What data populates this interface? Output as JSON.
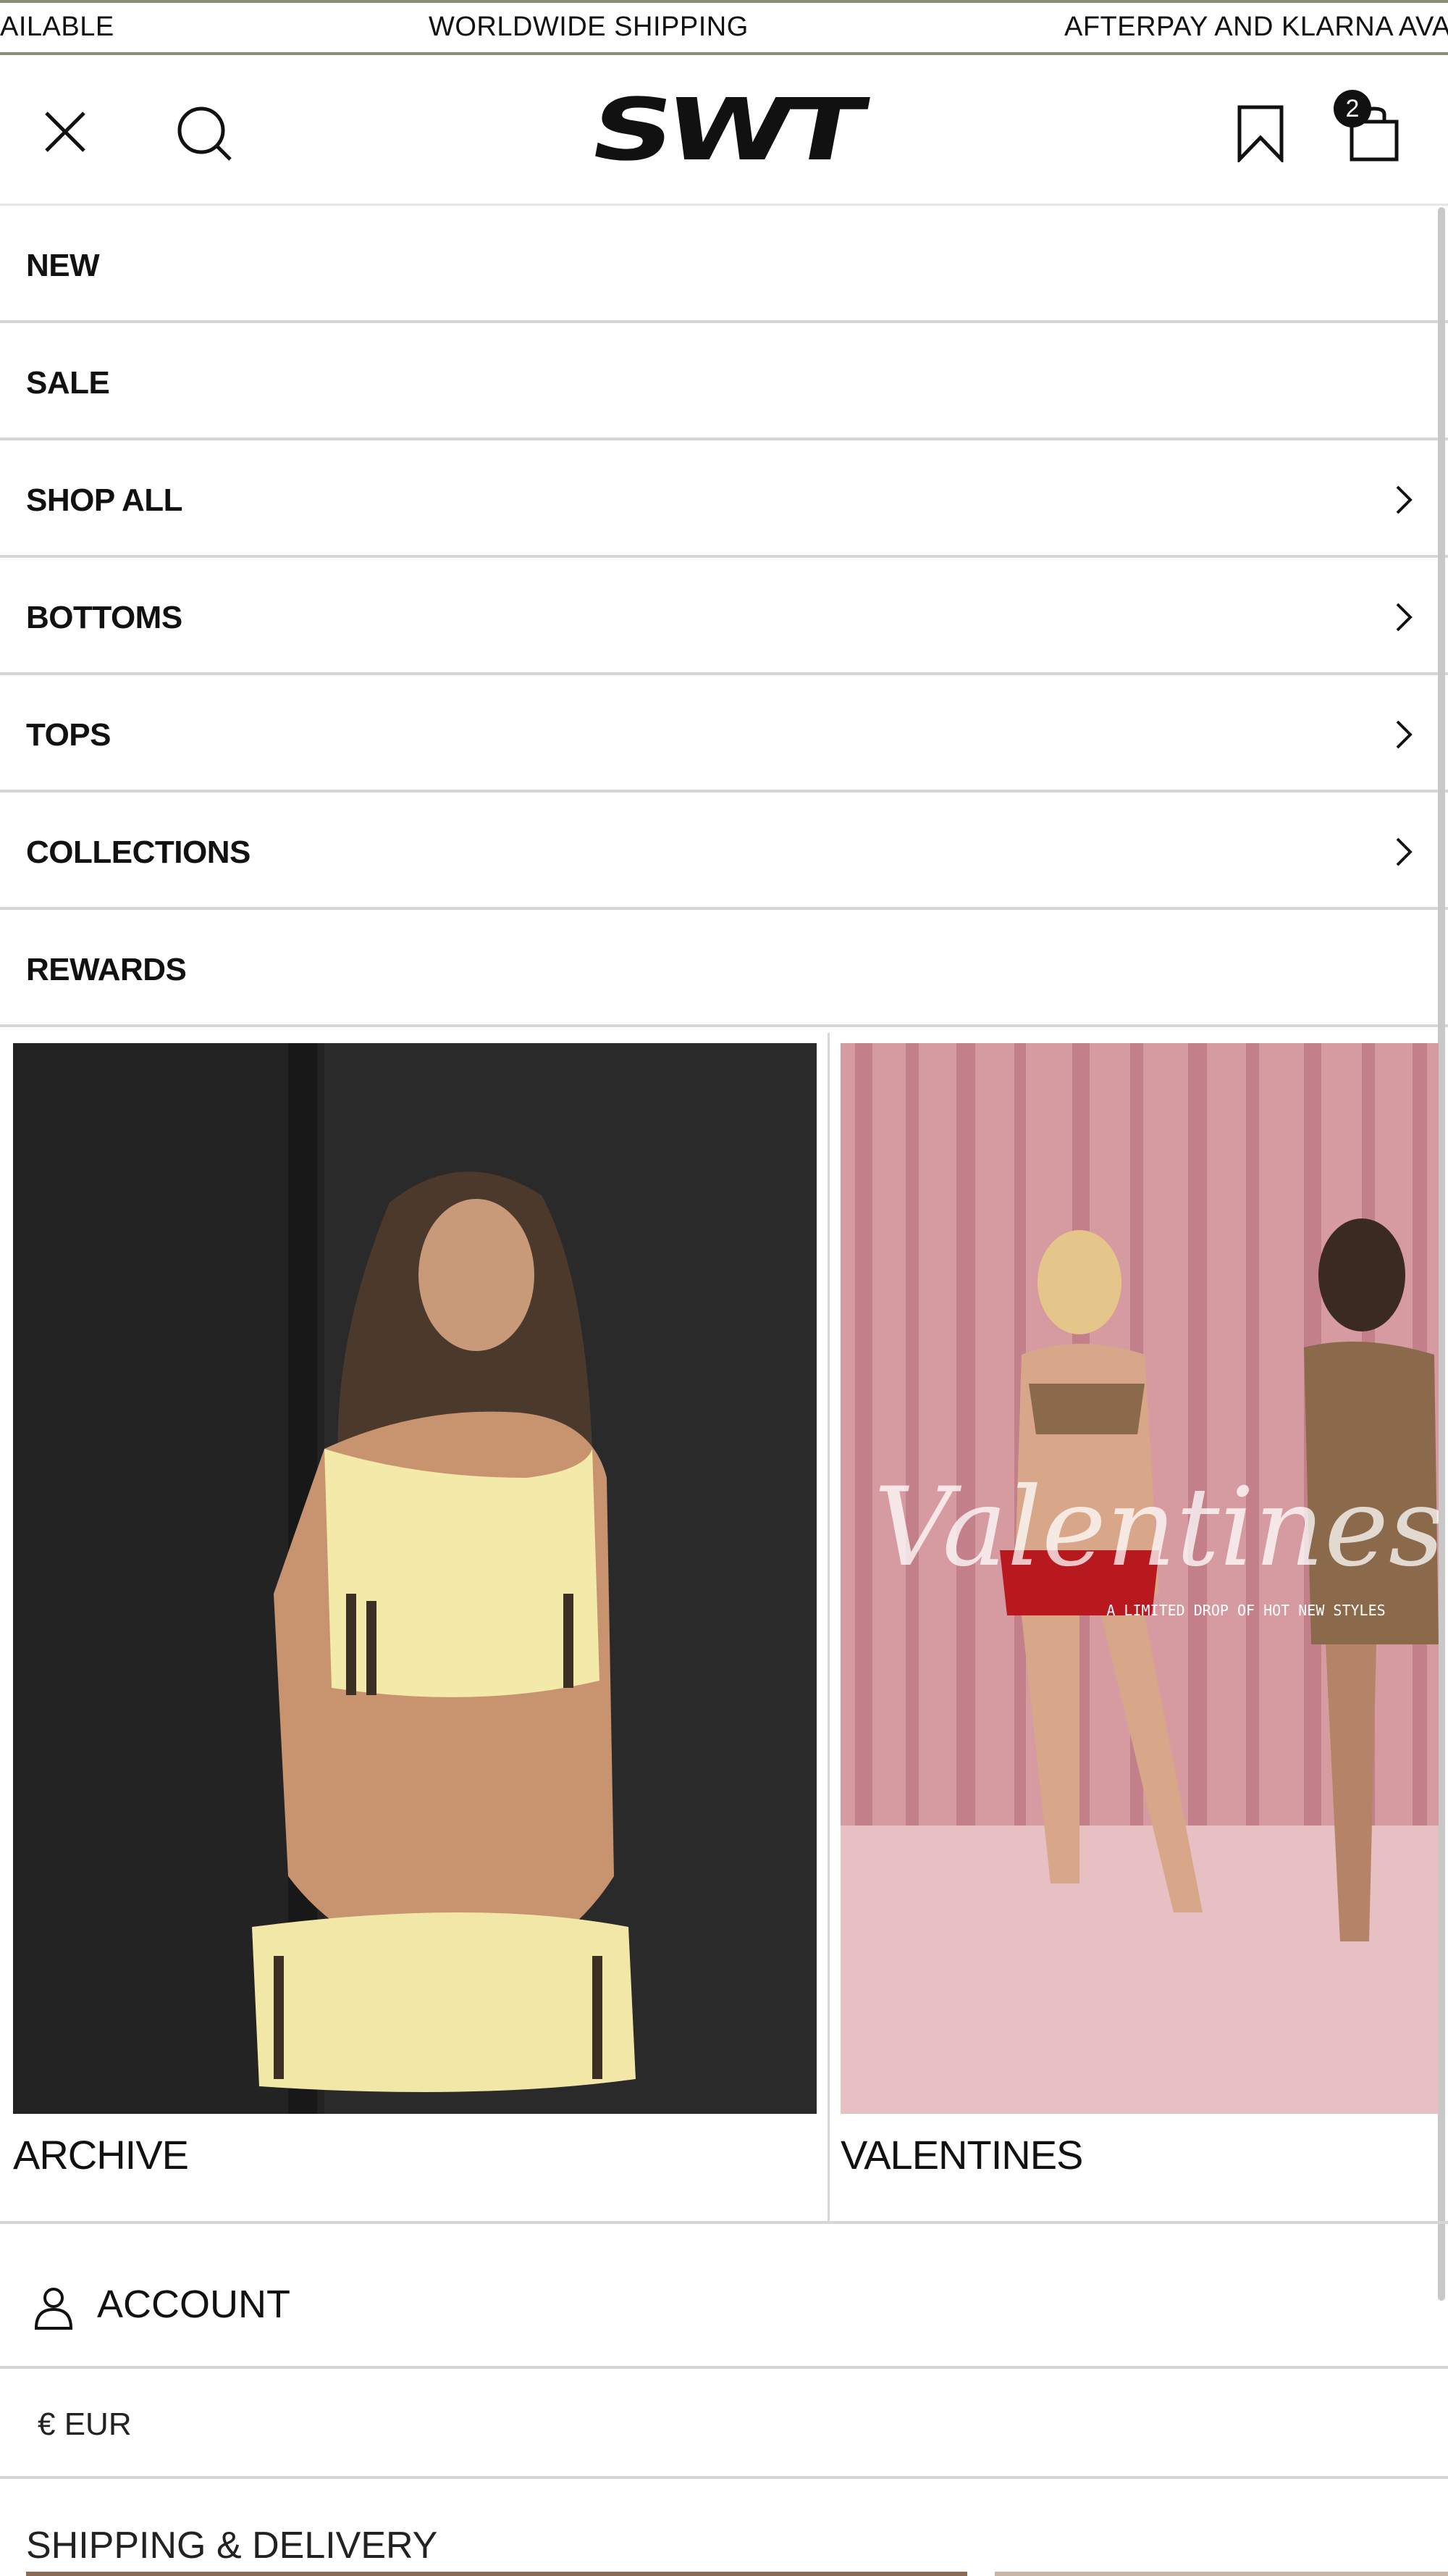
{
  "announcement": {
    "items": [
      "AILABLE",
      "WORLDWIDE SHIPPING",
      "AFTERPAY AND KLARNA AVA"
    ]
  },
  "header": {
    "logo_text": "SWT",
    "cart_count": "2",
    "icons": {
      "close": "close-icon",
      "search": "search-icon",
      "wishlist": "bookmark-icon",
      "cart": "shopping-bag-icon"
    }
  },
  "menu": {
    "items": [
      {
        "label": "NEW",
        "has_submenu": false
      },
      {
        "label": "SALE",
        "has_submenu": false
      },
      {
        "label": "SHOP ALL",
        "has_submenu": true
      },
      {
        "label": "BOTTOMS",
        "has_submenu": true
      },
      {
        "label": "TOPS",
        "has_submenu": true
      },
      {
        "label": "COLLECTIONS",
        "has_submenu": true
      },
      {
        "label": "REWARDS",
        "has_submenu": false
      }
    ]
  },
  "cards": [
    {
      "label": "ARCHIVE"
    },
    {
      "label": "VALENTINES",
      "overlay_script": "Valentines",
      "overlay_caption": "A LIMITED DROP OF HOT NEW STYLES"
    }
  ],
  "account": {
    "label": "ACCOUNT",
    "icon": "user-icon"
  },
  "currency": {
    "label": "€ EUR"
  },
  "footer_link": {
    "label": "SHIPPING & DELIVERY"
  },
  "colors": {
    "text": "#111111",
    "divider": "#d6d6d6",
    "marquee_border": "#8c8c7a",
    "pink_curtain": "#d99aa0"
  }
}
